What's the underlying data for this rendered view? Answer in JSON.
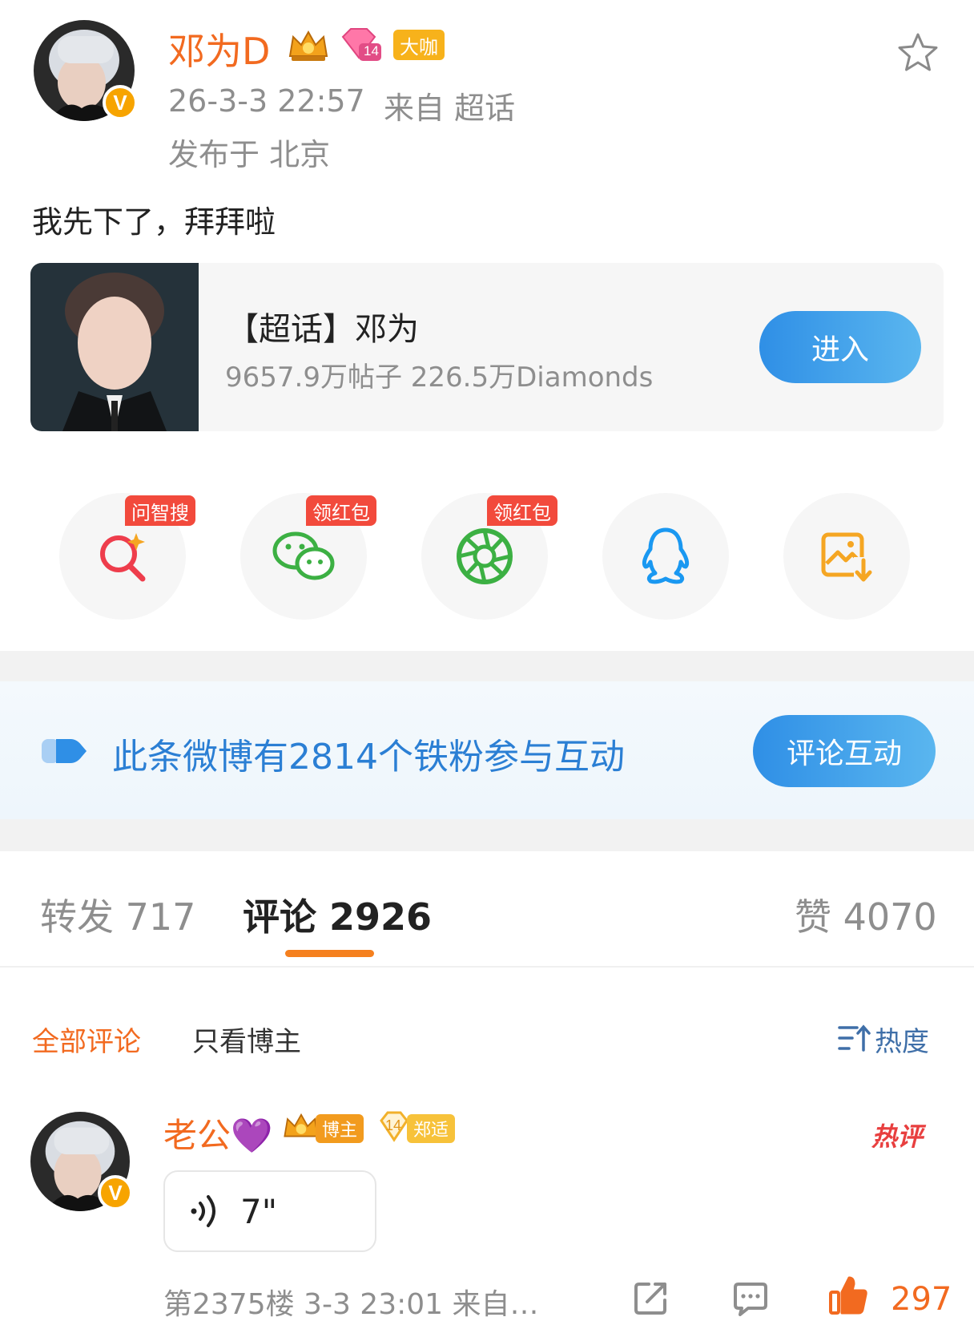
{
  "post": {
    "author": "邓为D",
    "level_badge": "14",
    "tag": "大咖",
    "time": "26-3-3 22:57",
    "source": "来自 超话",
    "location": "发布于 北京",
    "text": "我先下了，拜拜啦"
  },
  "topic_card": {
    "title": "【超话】邓为",
    "stats": "9657.9万帖子 226.5万Diamonds",
    "enter_label": "进入"
  },
  "share": {
    "items": [
      {
        "icon": "ask-search-icon",
        "tag": "问智搜"
      },
      {
        "icon": "wechat-icon",
        "tag": "领红包"
      },
      {
        "icon": "moments-icon",
        "tag": "领红包"
      },
      {
        "icon": "qq-icon",
        "tag": ""
      },
      {
        "icon": "save-image-icon",
        "tag": ""
      }
    ]
  },
  "fans_banner": {
    "text": "此条微博有2814个铁粉参与互动",
    "button": "评论互动"
  },
  "tabs": {
    "repost": "转发 717",
    "comment": "评论 2926",
    "like": "赞 4070"
  },
  "filter": {
    "all": "全部评论",
    "author_only": "只看博主",
    "sort": "热度"
  },
  "comment": {
    "name": "老公💜",
    "role_pill": "博主",
    "fan_level": "14",
    "fan_pill": "郑适",
    "hot": "热评",
    "voice_duration": "7\"",
    "meta": "第2375楼 3-3 23:01 来自…",
    "likes": "297"
  },
  "colors": {
    "brand_orange": "#f26a20",
    "blue": "#2f8fe6",
    "red_tag": "#f24a3c"
  }
}
